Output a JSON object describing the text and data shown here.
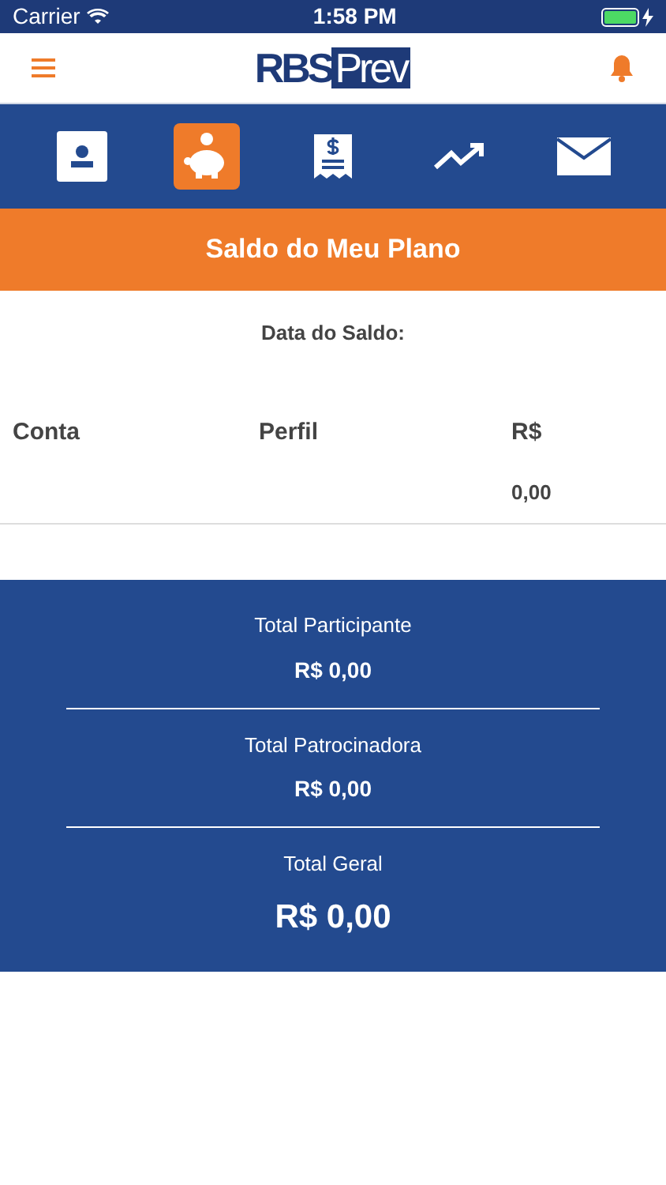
{
  "status_bar": {
    "carrier": "Carrier",
    "time": "1:58 PM"
  },
  "header": {
    "logo": {
      "part_1": "RBS",
      "part_2": "Prev"
    }
  },
  "nav": [
    {
      "kind": "profile",
      "selected": false
    },
    {
      "kind": "piggy",
      "selected": true
    },
    {
      "kind": "receipt",
      "selected": false
    },
    {
      "kind": "chart",
      "selected": false
    },
    {
      "kind": "mail",
      "selected": false
    }
  ],
  "title": "Saldo do Meu Plano",
  "balance_date_label": "Data do Saldo:",
  "table": {
    "columns": [
      "Conta",
      "Perfil",
      "R$"
    ],
    "rows": [
      {
        "cells": [
          "",
          "",
          "0,00"
        ]
      }
    ]
  },
  "totals": [
    {
      "label": "Total Participante",
      "value": "R$ 0,00",
      "kind": "normal"
    },
    {
      "label": "Total Patrocinadora",
      "value": "R$ 0,00",
      "kind": "normal"
    },
    {
      "label": "Total Geral",
      "value": "R$ 0,00",
      "kind": "grand"
    }
  ]
}
